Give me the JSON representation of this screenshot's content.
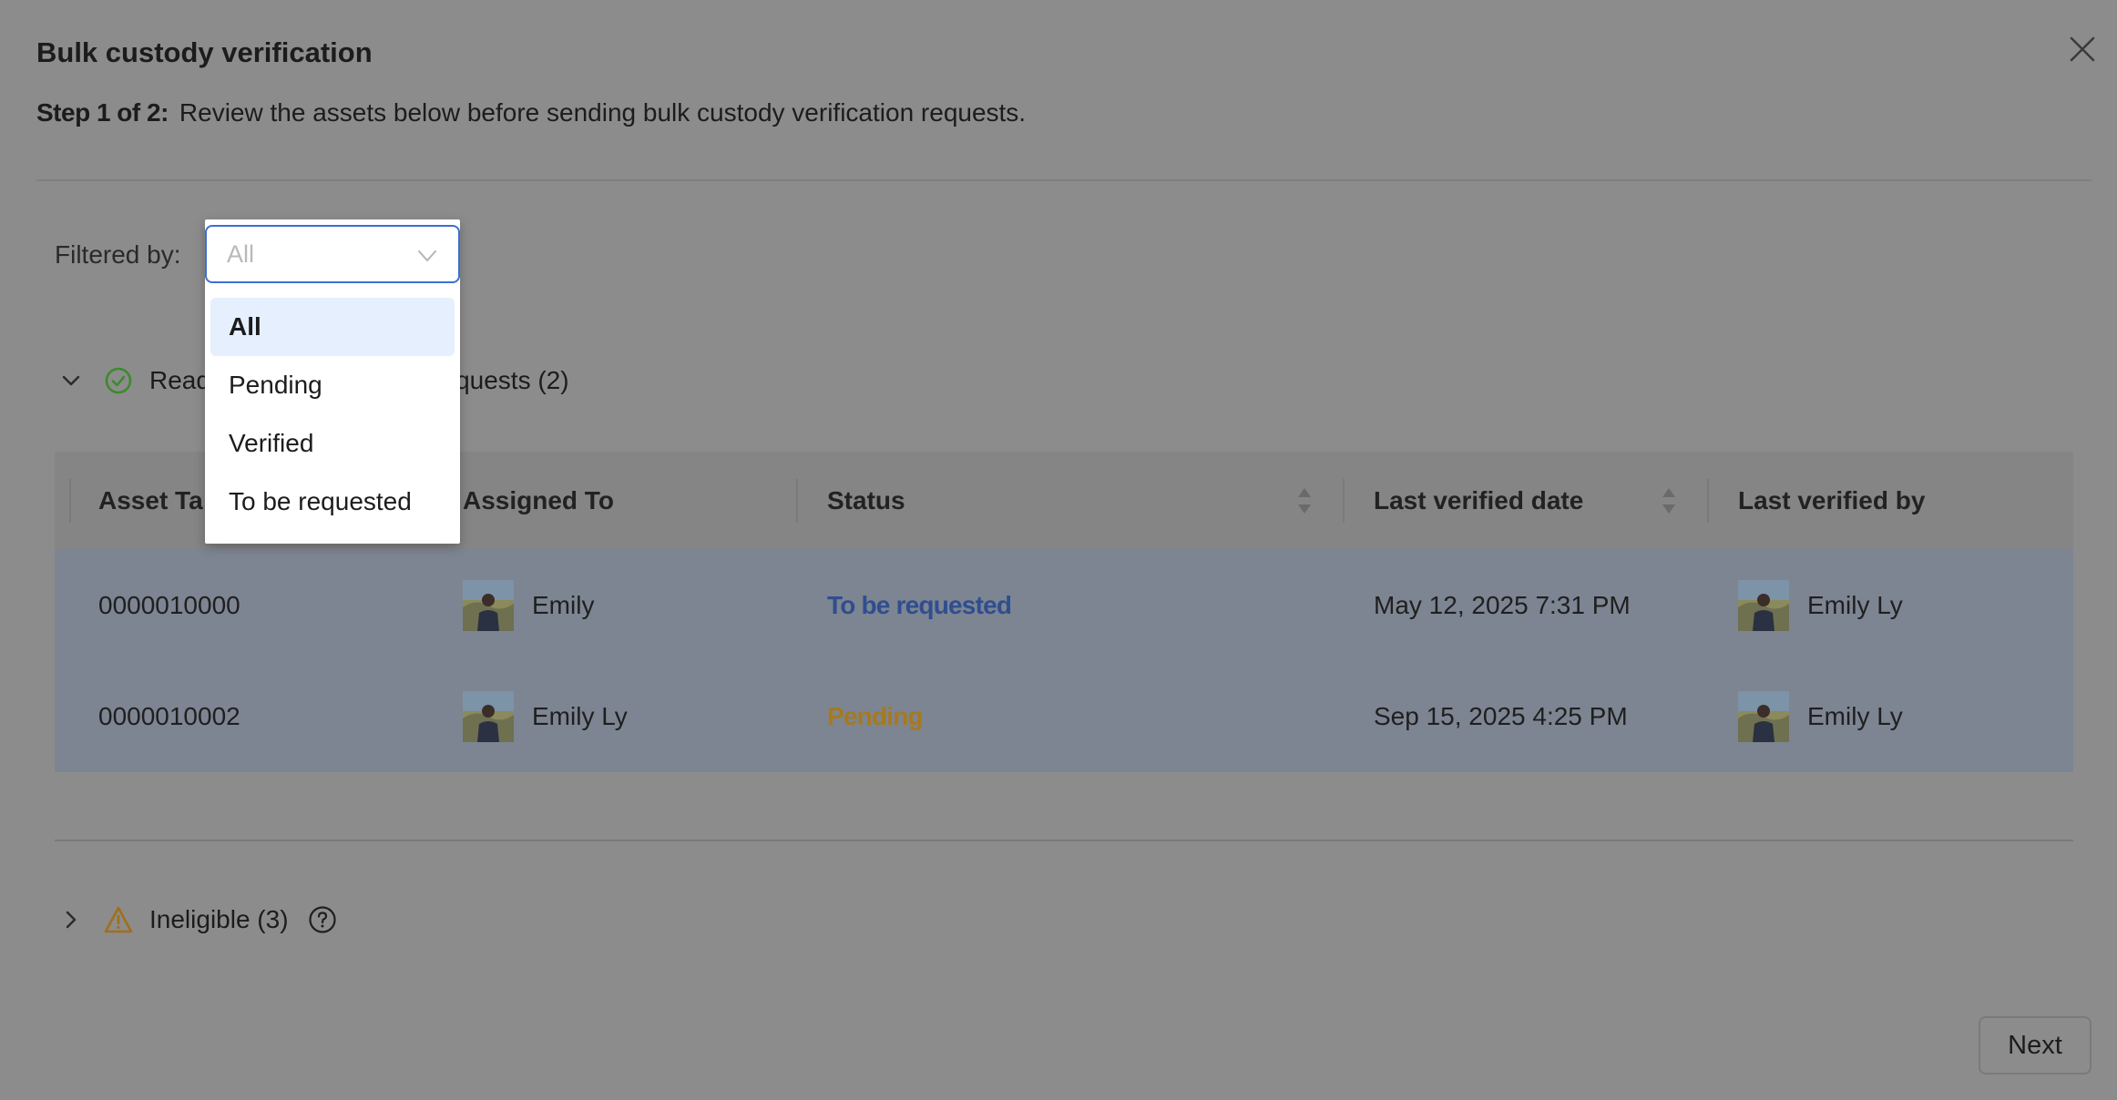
{
  "modal": {
    "title": "Bulk custody verification",
    "step_label": "Step 1 of 2:",
    "step_text": "Review the assets below before sending bulk custody verification requests."
  },
  "filter": {
    "label": "Filtered by:",
    "placeholder": "All",
    "options": [
      "All",
      "Pending",
      "Verified",
      "To be requested"
    ],
    "selected": "All"
  },
  "ready_section": {
    "label_visible_start": "Read",
    "label_visible_end": "n Requests (2)"
  },
  "table": {
    "columns": [
      "Asset Ta",
      "Assigned To",
      "Status",
      "Last verified date",
      "Last verified by"
    ],
    "rows": [
      {
        "asset_tag": "0000010000",
        "assigned_to": "Emily",
        "status": "To be requested",
        "last_verified_date": "May 12, 2025 7:31 PM",
        "last_verified_by": "Emily Ly"
      },
      {
        "asset_tag": "0000010002",
        "assigned_to": "Emily Ly",
        "status": "Pending",
        "last_verified_date": "Sep 15, 2025 4:25 PM",
        "last_verified_by": "Emily Ly"
      }
    ]
  },
  "ineligible": {
    "label": "Ineligible (3)"
  },
  "footer": {
    "next_label": "Next"
  },
  "colors": {
    "overlay": "#8c8c8c",
    "accent_blue": "#3b6fd4",
    "status_requested": "#2f4e8f",
    "status_pending": "#a7791e",
    "ready_green": "#3d8a2e",
    "warning_amber": "#a06f1a"
  },
  "icons": [
    "close-icon",
    "chevron-down-icon",
    "check-circle-icon",
    "warning-icon",
    "help-circle-icon",
    "sort-icon",
    "avatar-image"
  ]
}
